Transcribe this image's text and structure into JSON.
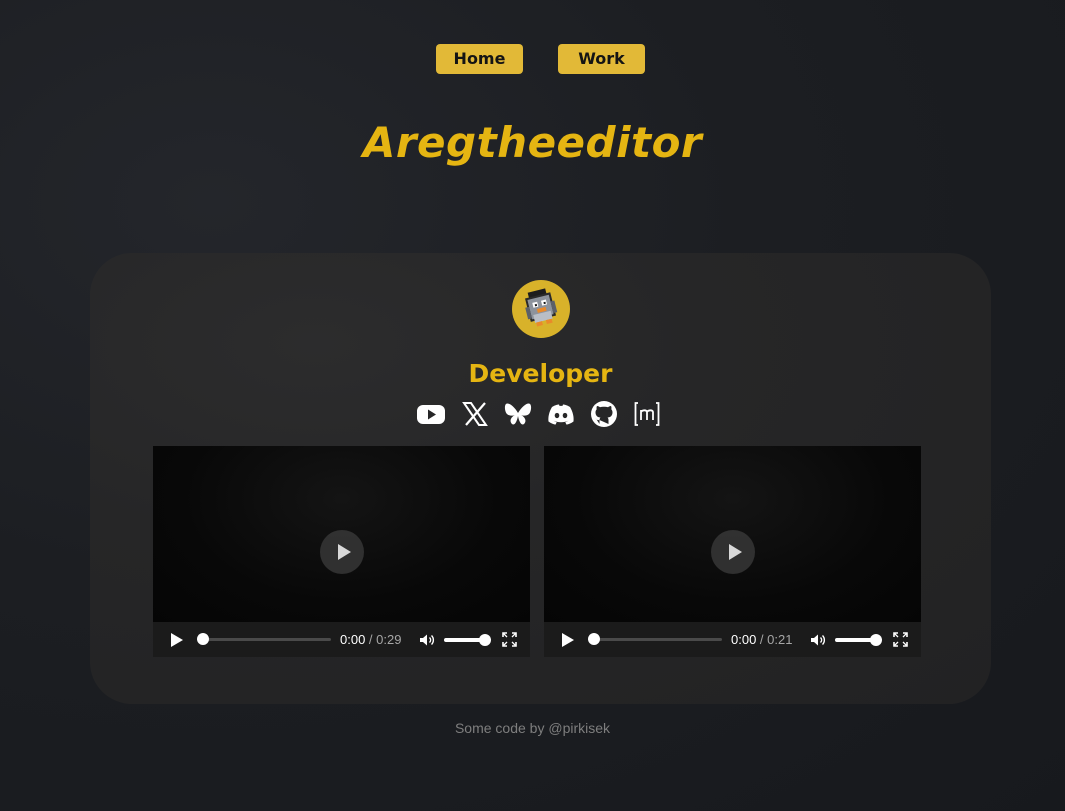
{
  "nav": {
    "home_label": "Home",
    "work_label": "Work"
  },
  "header": {
    "title": "Aregtheeditor"
  },
  "profile": {
    "avatar_icon": "pixel-penguin-avatar",
    "role": "Developer",
    "social_icons": [
      "youtube-icon",
      "x-twitter-icon",
      "bluesky-icon",
      "discord-icon",
      "github-icon",
      "matrix-icon"
    ]
  },
  "videos": [
    {
      "current_time": "0:00",
      "separator": " / ",
      "duration": "0:29",
      "volume": 1.0,
      "progress": 0.0
    },
    {
      "current_time": "0:00",
      "separator": " / ",
      "duration": "0:21",
      "volume": 1.0,
      "progress": 0.0
    }
  ],
  "footer": {
    "text": "Some code by @pirkisek"
  },
  "colors": {
    "accent": "#e5b512",
    "button_bg": "#e2b937",
    "card_bg": "#262627",
    "page_bg": "#1c1e22"
  }
}
